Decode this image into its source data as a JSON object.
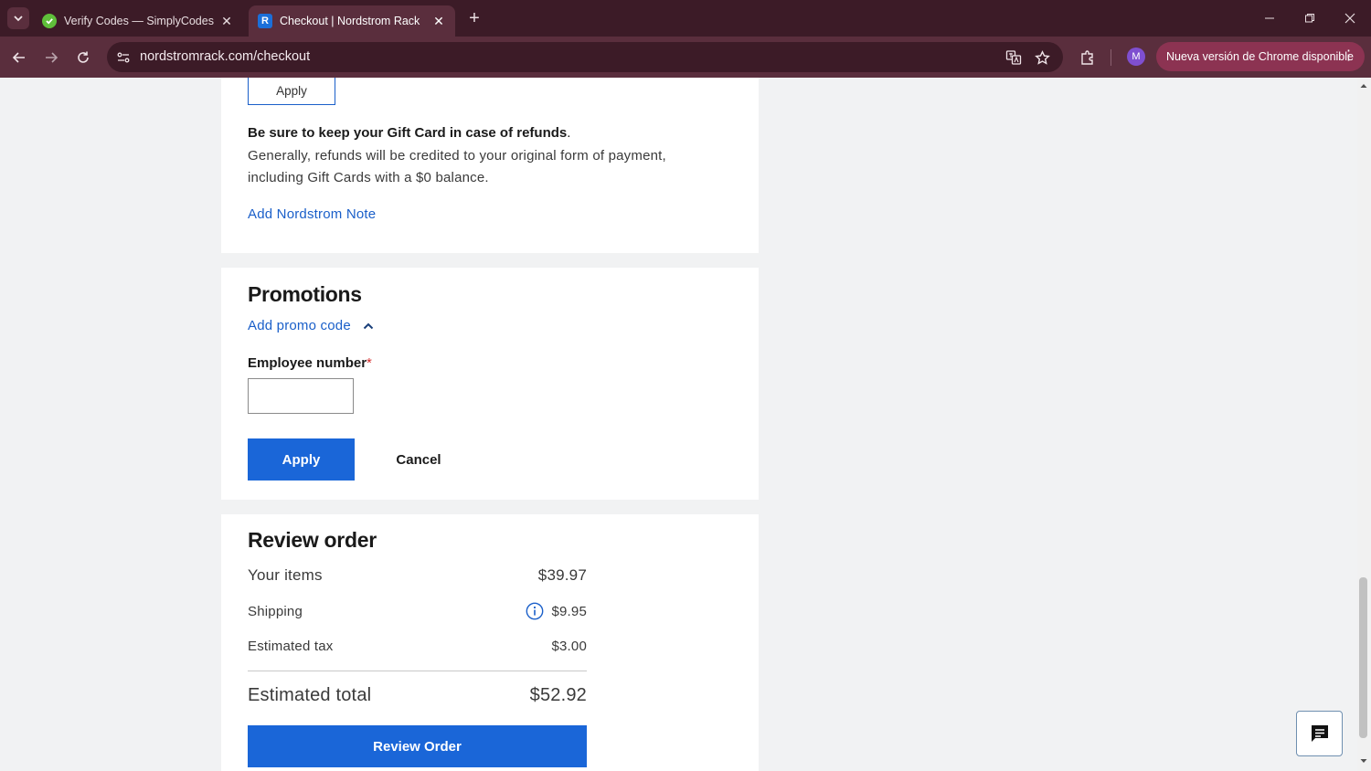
{
  "browser": {
    "tabs": [
      {
        "title": "Verify Codes — SimplyCodes",
        "active": false
      },
      {
        "title": "Checkout | Nordstrom Rack",
        "active": true
      }
    ],
    "tab_favicon_letter": "R",
    "url": "nordstromrack.com/checkout",
    "avatar_initial": "M",
    "update_label": "Nueva versión de Chrome disponible"
  },
  "payment": {
    "apply_label": "Apply",
    "giftcard_bold": "Be sure to keep your Gift Card in case of refunds",
    "giftcard_text": "Generally, refunds will be credited to your original form of payment, including Gift Cards with a $0 balance.",
    "note_link": "Add Nordstrom Note"
  },
  "promotions": {
    "title": "Promotions",
    "add_promo_link": "Add promo code",
    "employee_label": "Employee number",
    "required_mark": "*",
    "employee_value": "",
    "apply_label": "Apply",
    "cancel_label": "Cancel"
  },
  "review": {
    "title": "Review order",
    "items_label": "Your items",
    "items_value": "$39.97",
    "shipping_label": "Shipping",
    "shipping_value": "$9.95",
    "tax_label": "Estimated tax",
    "tax_value": "$3.00",
    "total_label": "Estimated total",
    "total_value": "$52.92",
    "button_label": "Review Order"
  },
  "colors": {
    "accent_blue": "#1a66d8",
    "link_blue": "#1a5fc9",
    "chrome_dark": "#3c1b27",
    "chrome_toolbar": "#5a2e3d",
    "update_pill": "#8c3352"
  }
}
